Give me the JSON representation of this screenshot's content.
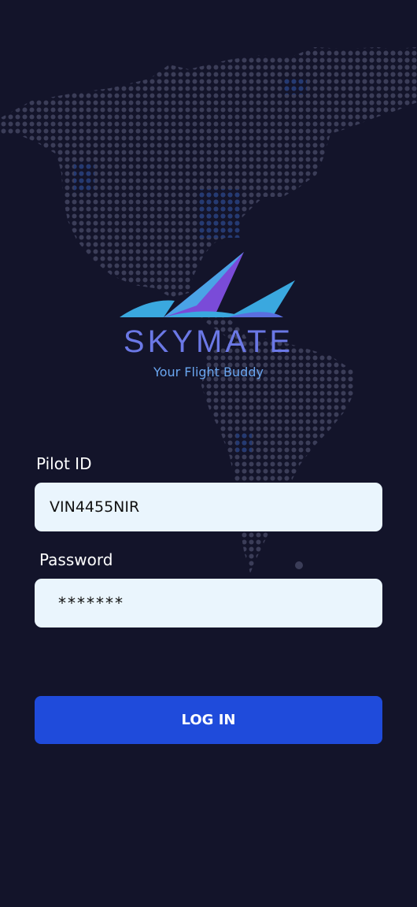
{
  "brand": {
    "name": "SKYMATE",
    "tagline": "Your Flight Buddy",
    "logo_icon": "plane-wings-icon"
  },
  "form": {
    "pilot_id": {
      "label": "Pilot ID",
      "value": "VIN4455NIR"
    },
    "password": {
      "label": "Password",
      "value": "*******"
    },
    "login_button": "LOG IN"
  },
  "colors": {
    "background": "#13142a",
    "accent": "#1f4bdb",
    "input_bg": "#eaf5fd",
    "brand_text": "#6b78e6",
    "tagline_text": "#6aa6f0"
  }
}
